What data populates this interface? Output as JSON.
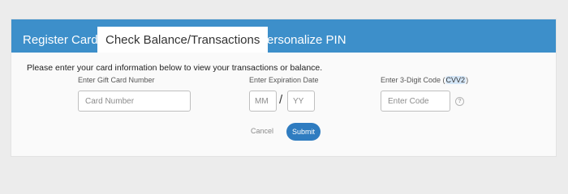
{
  "tabs": [
    {
      "label": "Register Card",
      "active": false
    },
    {
      "label": "Check Balance/Transactions",
      "active": true
    },
    {
      "label": "Personalize PIN",
      "active": false
    }
  ],
  "form": {
    "intro": "Please enter your card information below to view your transactions or balance.",
    "card_number": {
      "label": "Enter Gift Card Number",
      "placeholder": "Card Number",
      "value": ""
    },
    "expiration": {
      "label": "Enter Expiration Date",
      "month_placeholder": "MM",
      "year_placeholder": "YY",
      "separator": "/"
    },
    "cvv": {
      "label_prefix": "Enter 3-Digit Code (",
      "label_highlight": "CVV2",
      "label_suffix": ")",
      "placeholder": "Enter Code",
      "help_icon": "?"
    }
  },
  "actions": {
    "cancel_label": "Cancel",
    "submit_label": "Submit"
  },
  "colors": {
    "tab_bar": "#3d8fca",
    "submit": "#2f7cc0",
    "cvv_highlight": "#d4e6f7"
  }
}
